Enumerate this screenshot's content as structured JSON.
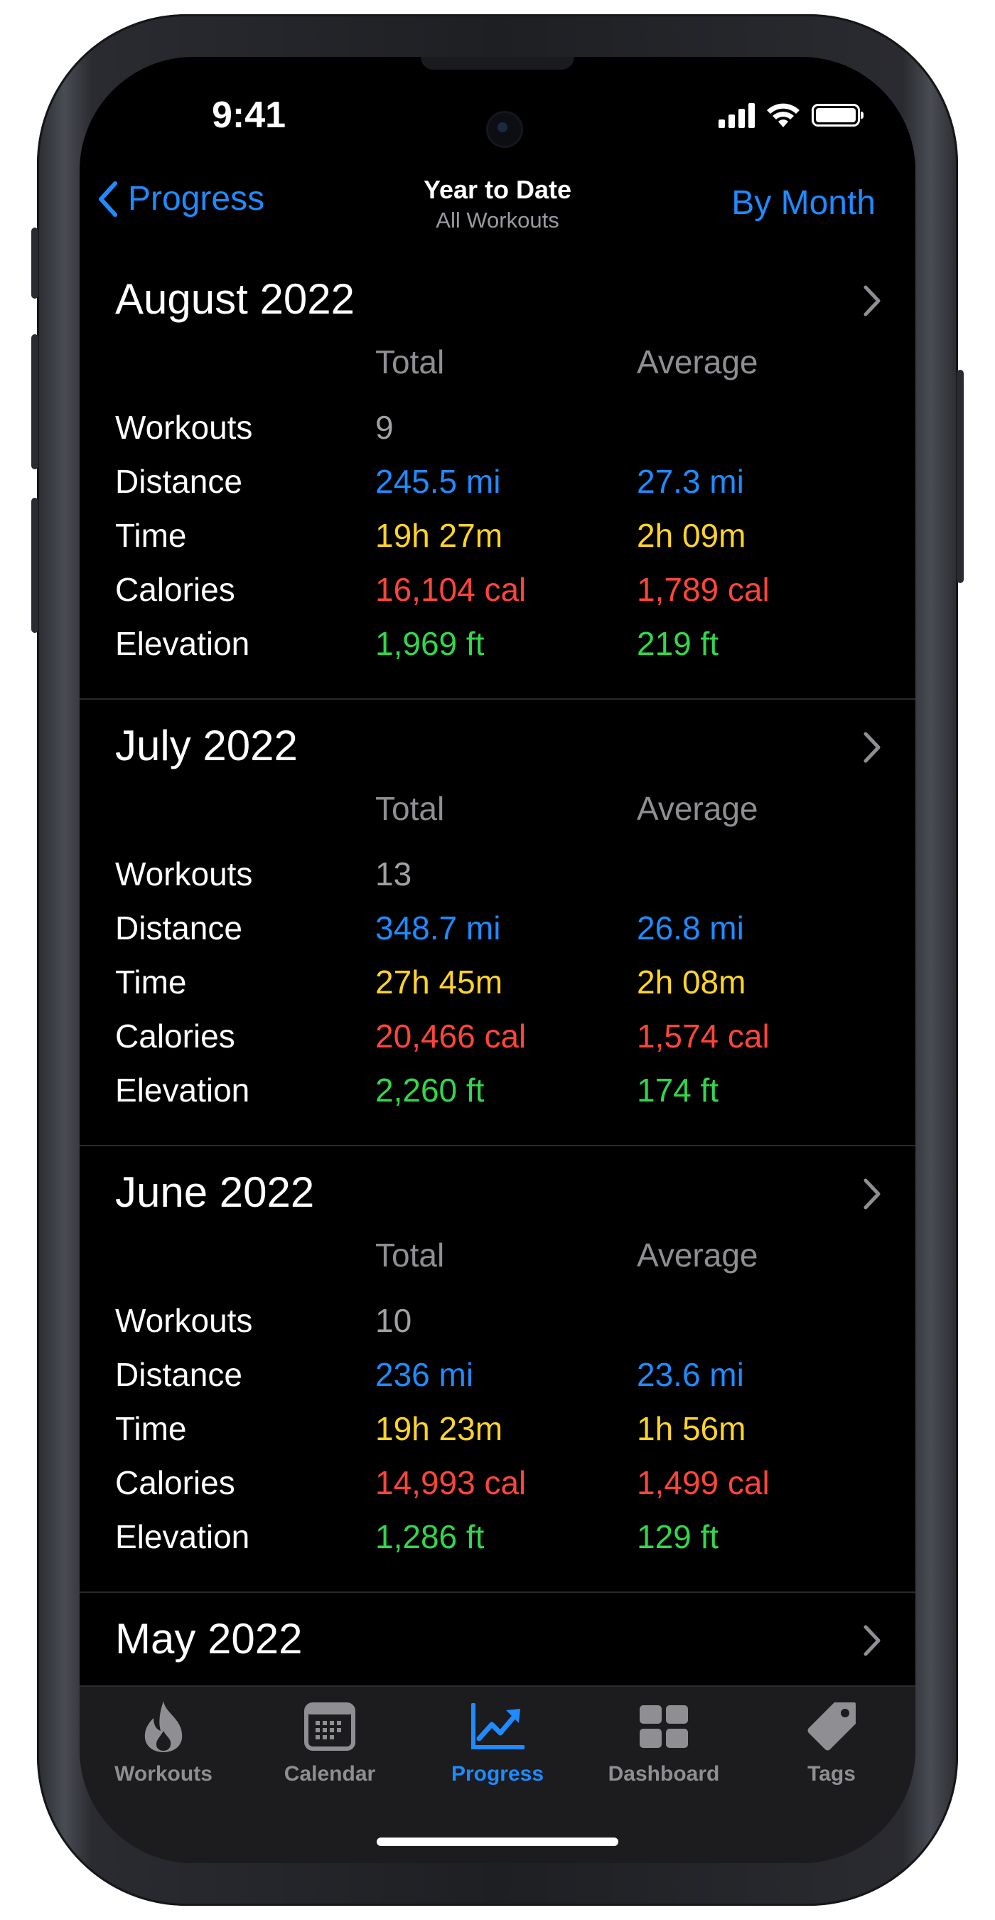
{
  "status_bar": {
    "time": "9:41"
  },
  "nav": {
    "back_label": "Progress",
    "title": "Year to Date",
    "subtitle": "All Workouts",
    "right_label": "By Month"
  },
  "columns": {
    "total": "Total",
    "average": "Average"
  },
  "row_labels": {
    "workouts": "Workouts",
    "distance": "Distance",
    "time": "Time",
    "calories": "Calories",
    "elevation": "Elevation"
  },
  "months": [
    {
      "title": "August 2022",
      "workouts": "9",
      "distance_total": "245.5 mi",
      "distance_avg": "27.3 mi",
      "time_total": "19h 27m",
      "time_avg": "2h 09m",
      "calories_total": "16,104 cal",
      "calories_avg": "1,789 cal",
      "elevation_total": "1,969 ft",
      "elevation_avg": "219 ft"
    },
    {
      "title": "July 2022",
      "workouts": "13",
      "distance_total": "348.7 mi",
      "distance_avg": "26.8 mi",
      "time_total": "27h 45m",
      "time_avg": "2h 08m",
      "calories_total": "20,466 cal",
      "calories_avg": "1,574 cal",
      "elevation_total": "2,260 ft",
      "elevation_avg": "174 ft"
    },
    {
      "title": "June 2022",
      "workouts": "10",
      "distance_total": "236 mi",
      "distance_avg": "23.6 mi",
      "time_total": "19h 23m",
      "time_avg": "1h 56m",
      "calories_total": "14,993 cal",
      "calories_avg": "1,499 cal",
      "elevation_total": "1,286 ft",
      "elevation_avg": "129 ft"
    },
    {
      "title": "May 2022"
    }
  ],
  "tabs": [
    {
      "label": "Workouts",
      "icon": "flame-icon"
    },
    {
      "label": "Calendar",
      "icon": "calendar-icon"
    },
    {
      "label": "Progress",
      "icon": "chart-trend-icon",
      "active": true
    },
    {
      "label": "Dashboard",
      "icon": "grid-icon"
    },
    {
      "label": "Tags",
      "icon": "tag-icon"
    }
  ],
  "colors": {
    "accent": "#1f8bff",
    "distance": "#1f8bff",
    "time": "#ffd426",
    "calories": "#ff453a",
    "elevation": "#32d74b"
  }
}
